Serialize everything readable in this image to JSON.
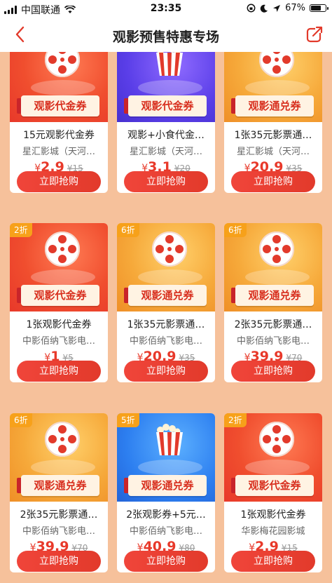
{
  "status_bar": {
    "carrier": "中国联通",
    "time": "23:35",
    "battery": "67%",
    "icons": [
      "signal-icon",
      "wifi-icon",
      "rotation-lock-icon",
      "moon-icon",
      "location-icon",
      "battery-icon"
    ]
  },
  "nav": {
    "back_icon": "chevron-left-icon",
    "title": "观影预售特惠专场",
    "share_icon": "share-icon"
  },
  "colors": {
    "accent": "#e23a2b",
    "badge": "#f7a11a",
    "background": "#f6c19b"
  },
  "products": [
    {
      "theme": "red",
      "art": "reel",
      "badge": "",
      "coupon_label": "观影代金券",
      "title": "15元观影代金券",
      "cinema": "星汇影城（天河…",
      "currency": "¥",
      "price": "2.9",
      "original": "¥15",
      "button": "立即抢购"
    },
    {
      "theme": "purple",
      "art": "popcorn",
      "badge": "",
      "coupon_label": "观影代金券",
      "title": "观影+小食代金…",
      "cinema": "星汇影城（天河…",
      "currency": "¥",
      "price": "3.1",
      "original": "¥20",
      "button": "立即抢购"
    },
    {
      "theme": "orange",
      "art": "reel",
      "badge": "",
      "coupon_label": "观影通兑券",
      "title": "1张35元影票通…",
      "cinema": "星汇影城（天河…",
      "currency": "¥",
      "price": "20.9",
      "original": "¥35",
      "button": "立即抢购"
    },
    {
      "theme": "red",
      "art": "reel",
      "badge": "2折",
      "coupon_label": "观影代金券",
      "title": "1张观影代金券",
      "cinema": "中影佰纳飞影电…",
      "currency": "¥",
      "price": "1",
      "original": "¥5",
      "button": "立即抢购"
    },
    {
      "theme": "orange",
      "art": "reel",
      "badge": "6折",
      "coupon_label": "观影通兑券",
      "title": "1张35元影票通…",
      "cinema": "中影佰纳飞影电…",
      "currency": "¥",
      "price": "20.9",
      "original": "¥35",
      "button": "立即抢购"
    },
    {
      "theme": "orange",
      "art": "reel",
      "badge": "6折",
      "coupon_label": "观影通兑券",
      "title": "2张35元影票通…",
      "cinema": "中影佰纳飞影电…",
      "currency": "¥",
      "price": "39.9",
      "original": "¥70",
      "button": "立即抢购"
    },
    {
      "theme": "orange",
      "art": "reel",
      "badge": "6折",
      "coupon_label": "观影通兑券",
      "title": "2张35元影票通…",
      "cinema": "中影佰纳飞影电…",
      "currency": "¥",
      "price": "39.9",
      "original": "¥70",
      "button": "立即抢购"
    },
    {
      "theme": "blue",
      "art": "popcorn",
      "badge": "5折",
      "coupon_label": "观影通兑券",
      "title": "2张观影券+5元…",
      "cinema": "中影佰纳飞影电…",
      "currency": "¥",
      "price": "40.9",
      "original": "¥80",
      "button": "立即抢购"
    },
    {
      "theme": "red",
      "art": "reel",
      "badge": "2折",
      "coupon_label": "观影代金券",
      "title": "1张观影代金券",
      "cinema": "华影梅花园影城",
      "currency": "¥",
      "price": "2.9",
      "original": "¥15",
      "button": "立即抢购"
    }
  ]
}
